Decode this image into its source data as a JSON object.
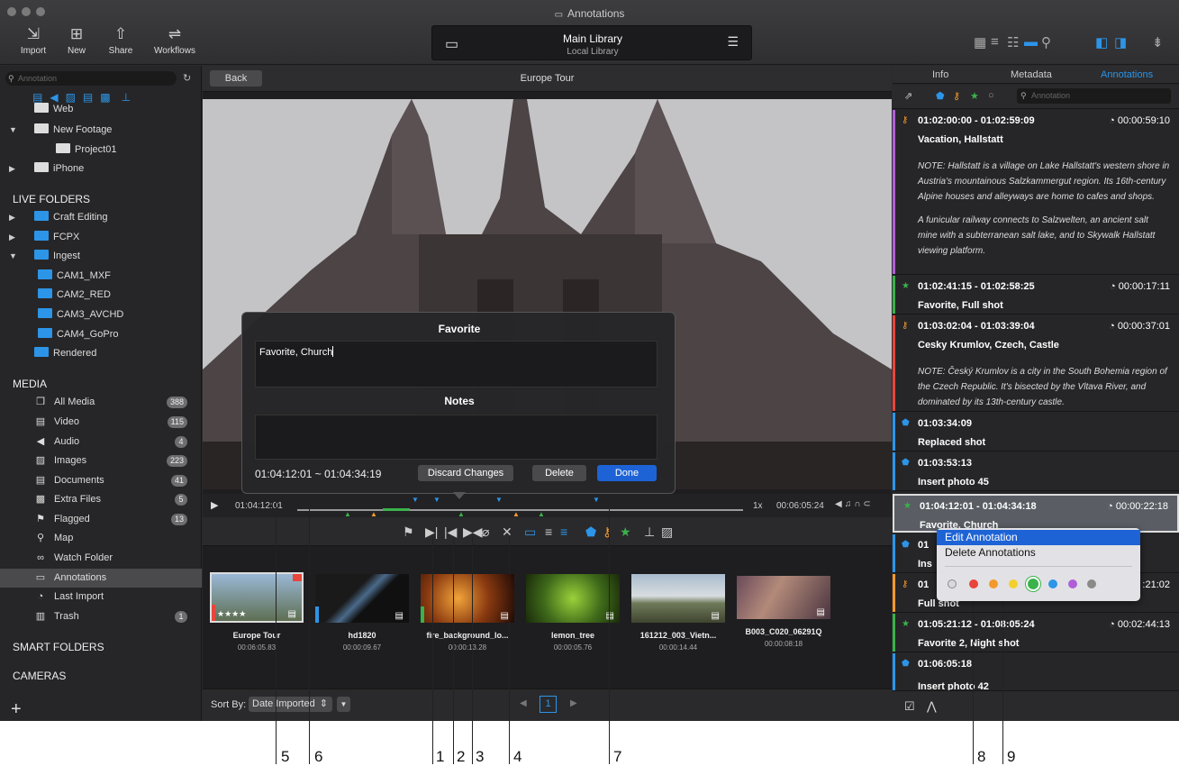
{
  "window": {
    "title": "Annotations"
  },
  "toolbar": {
    "buttons": [
      {
        "label": "Import",
        "icon": "import-icon"
      },
      {
        "label": "New",
        "icon": "new-icon"
      },
      {
        "label": "Share",
        "icon": "share-icon"
      },
      {
        "label": "Workflows",
        "icon": "workflows-icon"
      }
    ],
    "library_title": "Main Library",
    "library_subtitle": "Local Library"
  },
  "sidebar": {
    "search_placeholder": "Annotation",
    "tree": [
      {
        "label": "Web"
      },
      {
        "label": "New Footage"
      },
      {
        "label": "Project01"
      },
      {
        "label": "iPhone"
      }
    ],
    "live_folders_heading": "LIVE FOLDERS",
    "live_folders": [
      {
        "label": "Craft Editing"
      },
      {
        "label": "FCPX"
      },
      {
        "label": "Ingest"
      },
      {
        "label": "CAM1_MXF"
      },
      {
        "label": "CAM2_RED"
      },
      {
        "label": "CAM3_AVCHD"
      },
      {
        "label": "CAM4_GoPro"
      },
      {
        "label": "Rendered"
      }
    ],
    "media_heading": "MEDIA",
    "media": [
      {
        "label": "All Media",
        "count": "388"
      },
      {
        "label": "Video",
        "count": "115"
      },
      {
        "label": "Audio",
        "count": "4"
      },
      {
        "label": "Images",
        "count": "223"
      },
      {
        "label": "Documents",
        "count": "41"
      },
      {
        "label": "Extra Files",
        "count": "5"
      },
      {
        "label": "Flagged",
        "count": "13"
      },
      {
        "label": "Map",
        "count": ""
      },
      {
        "label": "Watch Folder",
        "count": ""
      },
      {
        "label": "Annotations",
        "count": ""
      },
      {
        "label": "Last Import",
        "count": ""
      },
      {
        "label": "Trash",
        "count": "1"
      }
    ],
    "smart_folders_heading": "SMART FOLDERS",
    "cameras_heading": "CAMERAS"
  },
  "viewer": {
    "back_label": "Back",
    "clip_title": "Europe Tour",
    "current_time": "01:04:12:01",
    "speed": "1x",
    "duration": "00:06:05:24"
  },
  "dialog": {
    "title": "Favorite",
    "favorite_text": "Favorite, Church",
    "notes_heading": "Notes",
    "range": "01:04:12:01 ~ 01:04:34:19",
    "discard_label": "Discard Changes",
    "delete_label": "Delete",
    "done_label": "Done"
  },
  "clips": [
    {
      "name": "Europe Tour",
      "duration": "00:06:05.83",
      "rating": "★★★★"
    },
    {
      "name": "hd1820",
      "duration": "00:00:09.67"
    },
    {
      "name": "fire_background_lo...",
      "duration": "00:00:13.28"
    },
    {
      "name": "lemon_tree",
      "duration": "00:00:05.76"
    },
    {
      "name": "161212_003_Vietn...",
      "duration": "00:00:14.44"
    },
    {
      "name": "B003_C020_06291Q",
      "duration": "00:00:08:18"
    }
  ],
  "bottom": {
    "sort_label": "Sort By:",
    "sort_value": "Date Imported",
    "page": "1"
  },
  "right_panel": {
    "tabs": [
      "Info",
      "Metadata",
      "Annotations"
    ],
    "search_placeholder": "Annotation",
    "annotations": [
      {
        "range": "01:02:00:00 - 01:02:59:09",
        "duration": "00:00:59:10",
        "title": "Vacation, Hallstatt",
        "note": "NOTE: Hallstatt is a village on Lake Hallstatt's western shore in Austria's mountainous Salzkammergut region. Its 16th-century Alpine houses and alleyways are home to cafes and shops.",
        "note2": "A funicular railway connects to Salzwelten, an ancient salt mine with a subterranean salt lake, and to Skywalk Hallstatt viewing platform."
      },
      {
        "range": "01:02:41:15 - 01:02:58:25",
        "duration": "00:00:17:11",
        "title": "Favorite,  Full shot"
      },
      {
        "range": "01:03:02:04 - 01:03:39:04",
        "duration": "00:00:37:01",
        "title": "Cesky Krumlov, Czech, Castle",
        "note": "NOTE: Český Krumlov is a city in the South Bohemia region of the Czech Republic. It's bisected by the Vltava River, and dominated by its 13th-century castle."
      },
      {
        "range": "01:03:34:09",
        "title": "Replaced shot"
      },
      {
        "range": "01:03:53:13",
        "title": "Insert photo 45"
      },
      {
        "range": "01:04:12:01 - 01:04:34:18",
        "duration": "00:00:22:18",
        "title": "Favorite,  Church"
      },
      {
        "range": "01",
        "title": "Ins"
      },
      {
        "range": "01",
        "duration": ":21:02",
        "title": "Full shot"
      },
      {
        "range": "01:05:21:12 - 01:08:05:24",
        "duration": "00:02:44:13",
        "title": "Favorite 2,  Night shot"
      },
      {
        "range": "01:06:05:18",
        "title": "Insert photo 42"
      }
    ]
  },
  "context_menu": {
    "items": [
      "Edit Annotation",
      "Delete Annotations"
    ],
    "colors": [
      "#8a8a8a",
      "#e8453c",
      "#f39a2b",
      "#f5cf2d",
      "#3bb24b",
      "#2c95e8",
      "#b05fd8",
      "#8a8a8a"
    ]
  },
  "callouts": [
    "1",
    "2",
    "3",
    "4",
    "5",
    "6",
    "7",
    "8",
    "9"
  ]
}
